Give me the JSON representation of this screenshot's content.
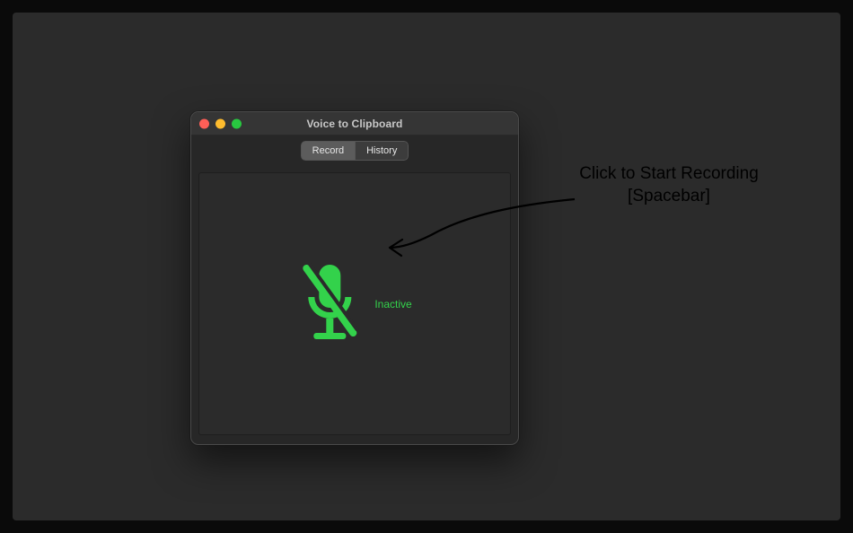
{
  "window": {
    "title": "Voice to Clipboard",
    "tabs": {
      "record": "Record",
      "history": "History"
    },
    "status_label": "Inactive"
  },
  "annotation": {
    "line1": "Click to Start Recording",
    "line2": "[Spacebar]"
  },
  "colors": {
    "accent_green": "#33d24b"
  }
}
